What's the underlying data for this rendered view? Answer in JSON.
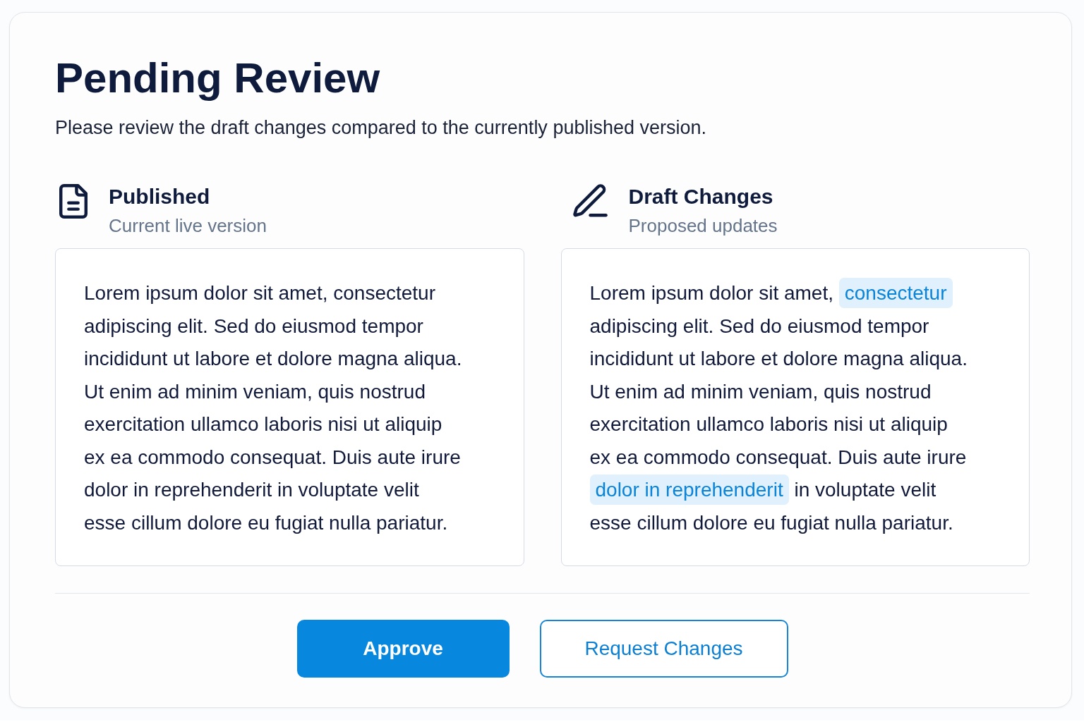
{
  "title": "Pending Review",
  "description": "Please review the draft changes compared to the currently published version.",
  "sections": [
    {
      "kind": "published",
      "heading": "Published",
      "subheading": "Current live version",
      "segments": [
        {
          "text": "Lorem ipsum dolor sit amet, consectetur\nadipiscing elit. Sed do eiusmod tempor\nincididunt ut labore et dolore magna aliqua.\nUt enim ad minim veniam, quis nostrud\nexercitation ullamco laboris nisi ut aliquip\nex ea commodo consequat. Duis aute irure\ndolor in reprehenderit in voluptate velit\nesse cillum dolore eu fugiat nulla pariatur.",
          "changed": false
        }
      ]
    },
    {
      "kind": "draft",
      "heading": "Draft Changes",
      "subheading": "Proposed updates",
      "segments": [
        {
          "text": "Lorem ipsum dolor sit amet, ",
          "changed": false
        },
        {
          "text": "consectetur",
          "changed": true
        },
        {
          "text": "\nadipiscing elit. Sed do eiusmod tempor\nincididunt ut labore et dolore magna aliqua.\nUt enim ad minim veniam, quis nostrud\nexercitation ullamco laboris nisi ut aliquip\nex ea commodo consequat. Duis aute irure\n",
          "changed": false
        },
        {
          "text": "dolor in reprehenderit",
          "changed": true
        },
        {
          "text": " in voluptate velit\nesse cillum dolore eu fugiat nulla pariatur.",
          "changed": false
        }
      ]
    }
  ],
  "buttons": [
    {
      "label": "Approve",
      "kind": "primary"
    },
    {
      "label": "Request Changes",
      "kind": "secondary"
    }
  ]
}
